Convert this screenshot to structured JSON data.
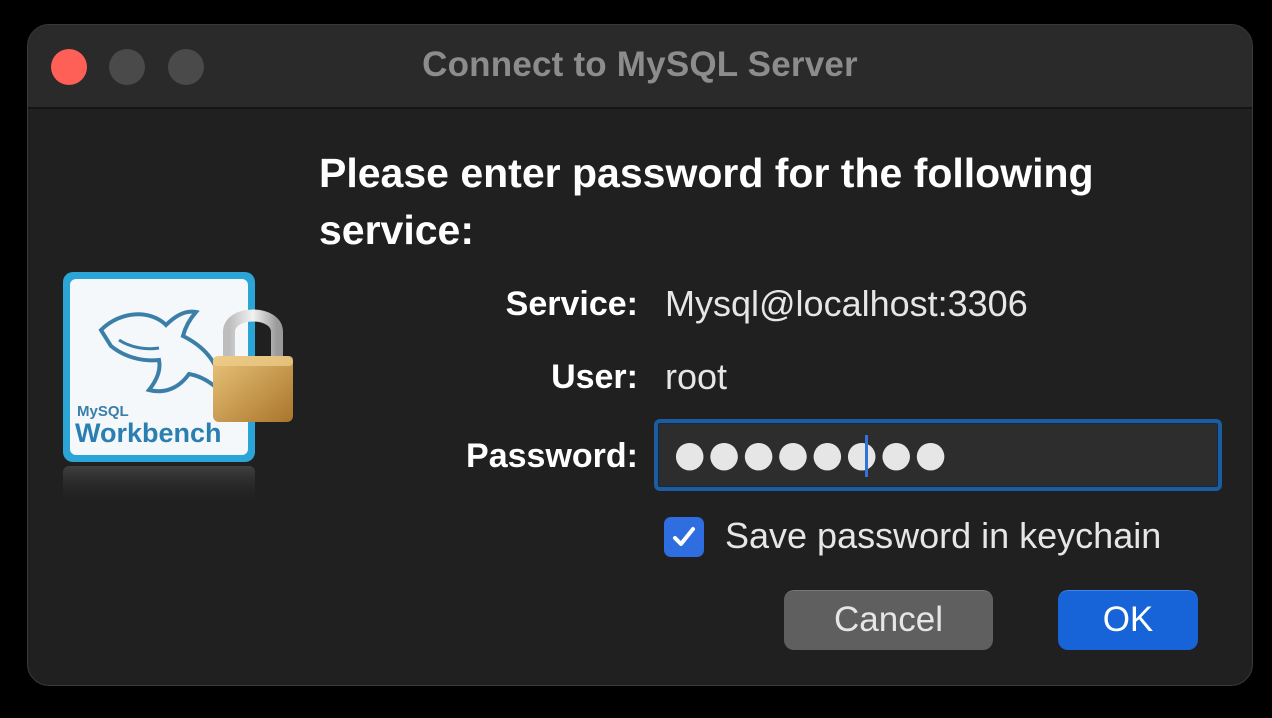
{
  "window": {
    "title": "Connect to MySQL Server"
  },
  "dialog": {
    "heading": "Please enter password for the following service:",
    "service_label": "Service:",
    "service_value": "Mysql@localhost:3306",
    "user_label": "User:",
    "user_value": "root",
    "password_label": "Password:",
    "password_masked": "●●●●●●●●",
    "save_password_label": "Save password in keychain",
    "save_password_checked": true,
    "cancel_label": "Cancel",
    "ok_label": "OK"
  },
  "logo": {
    "brand_small": "MySQL",
    "brand_large": "Workbench"
  },
  "colors": {
    "close": "#fe5f57",
    "accent": "#1764d8",
    "background": "#202020"
  }
}
